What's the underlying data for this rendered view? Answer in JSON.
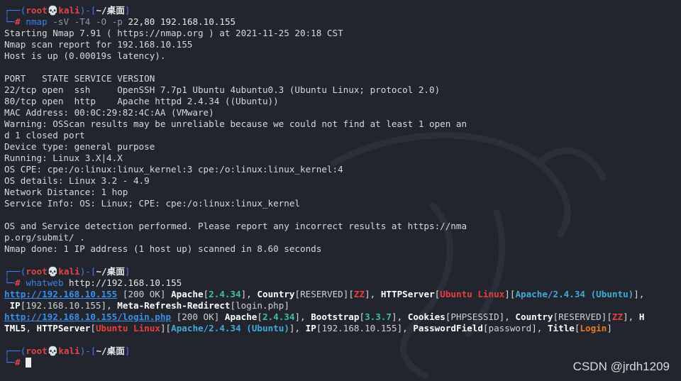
{
  "prompt": {
    "corner_top": "┌──(",
    "user": "root",
    "skull": "💀",
    "host": "kali",
    "mid": ")-[",
    "dir": "~/桌面",
    "end": "]",
    "corner_bot": "└─",
    "hash": "#"
  },
  "cmd1": {
    "name": "nmap",
    "flags": "-sV -T4 -O -p",
    "args": "22,80 192.168.10.155"
  },
  "nmap_output": [
    "Starting Nmap 7.91 ( https://nmap.org ) at 2021-11-25 20:18 CST",
    "Nmap scan report for 192.168.10.155",
    "Host is up (0.00019s latency).",
    "",
    "PORT   STATE SERVICE VERSION",
    "22/tcp open  ssh     OpenSSH 7.7p1 Ubuntu 4ubuntu0.3 (Ubuntu Linux; protocol 2.0)",
    "80/tcp open  http    Apache httpd 2.4.34 ((Ubuntu))",
    "MAC Address: 00:0C:29:82:4C:AA (VMware)",
    "Warning: OSScan results may be unreliable because we could not find at least 1 open an",
    "d 1 closed port",
    "Device type: general purpose",
    "Running: Linux 3.X|4.X",
    "OS CPE: cpe:/o:linux:linux_kernel:3 cpe:/o:linux:linux_kernel:4",
    "OS details: Linux 3.2 - 4.9",
    "Network Distance: 1 hop",
    "Service Info: OS: Linux; CPE: cpe:/o:linux:linux_kernel",
    "",
    "OS and Service detection performed. Please report any incorrect results at https://nma",
    "p.org/submit/ .",
    "Nmap done: 1 IP address (1 host up) scanned in 8.60 seconds"
  ],
  "cmd2": {
    "name": "whatweb",
    "args": "http://192.168.10.155"
  },
  "whatweb": {
    "r1_url": "http://192.168.10.155",
    "r1_status": " [200 OK] ",
    "apache_k": "Apache",
    "apache_v": "2.4.34",
    "country_k": "Country",
    "country_v": "RESERVED",
    "country_code": "ZZ",
    "httpserver_k": "HTTPServer",
    "httpserver_os": "Ubuntu Linux",
    "httpserver_v": "Apache/2.4.34 (Ubuntu)",
    "ip_k": "IP",
    "ip_v": "192.168.10.155",
    "meta_k": "Meta-Refresh-Redirect",
    "meta_v": "login.php",
    "r2_url": "http://192.168.10.155/login.php",
    "bootstrap_k": "Bootstrap",
    "bootstrap_v": "3.3.7",
    "cookies_k": "Cookies",
    "cookies_v": "PHPSESSID",
    "h_tail": "H",
    "html5_k": "TML5",
    "pwd_k": "PasswordField",
    "pwd_v": "password",
    "title_k": "Title",
    "title_v": "Login"
  },
  "watermark": "CSDN @jrdh1209"
}
